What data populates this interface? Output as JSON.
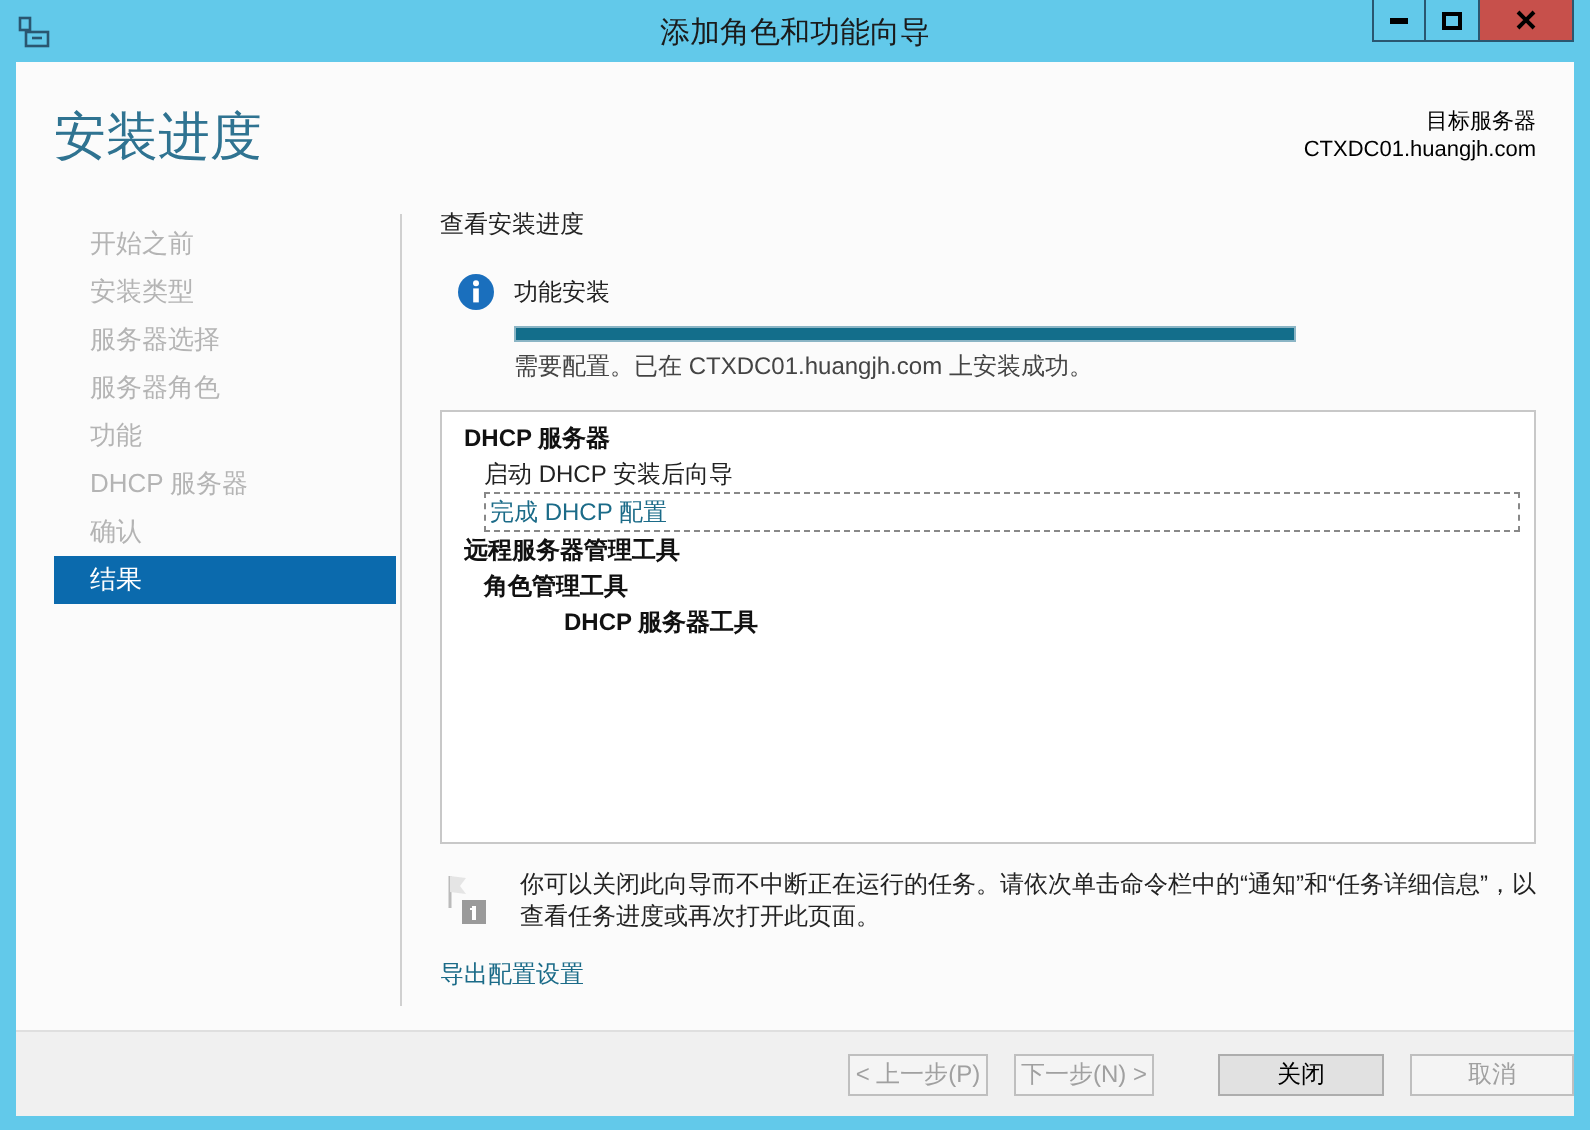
{
  "window": {
    "title": "添加角色和功能向导"
  },
  "page_title": "安装进度",
  "target": {
    "label": "目标服务器",
    "server": "CTXDC01.huangjh.com"
  },
  "nav": [
    {
      "label": "开始之前",
      "selected": false
    },
    {
      "label": "安装类型",
      "selected": false
    },
    {
      "label": "服务器选择",
      "selected": false
    },
    {
      "label": "服务器角色",
      "selected": false
    },
    {
      "label": "功能",
      "selected": false
    },
    {
      "label": "DHCP 服务器",
      "selected": false
    },
    {
      "label": "确认",
      "selected": false
    },
    {
      "label": "结果",
      "selected": true
    }
  ],
  "section_title": "查看安装进度",
  "status": {
    "title": "功能安装",
    "level": 1,
    "message": "需要配置。已在 CTXDC01.huangjh.com 上安装成功。"
  },
  "results": [
    {
      "kind": "heading",
      "text": "DHCP 服务器",
      "children": [
        {
          "kind": "text",
          "text": "启动 DHCP 安装后向导"
        },
        {
          "kind": "link",
          "text": "完成 DHCP 配置",
          "focused": true
        }
      ]
    },
    {
      "kind": "heading",
      "text": "远程服务器管理工具",
      "children": [
        {
          "kind": "heading",
          "text": "角色管理工具",
          "children": [
            {
              "kind": "heading",
              "text": "DHCP 服务器工具"
            }
          ]
        }
      ]
    }
  ],
  "note": "你可以关闭此向导而不中断正在运行的任务。请依次单击命令栏中的“通知”和“任务详细信息”，以查看任务进度或再次打开此页面。",
  "export_link": "导出配置设置",
  "buttons": [
    {
      "label": "< 上一步(P)",
      "disabled": true
    },
    {
      "label": "下一步(N) >",
      "disabled": true
    },
    {
      "label": "关闭",
      "disabled": false
    },
    {
      "label": "取消",
      "disabled": true
    }
  ]
}
